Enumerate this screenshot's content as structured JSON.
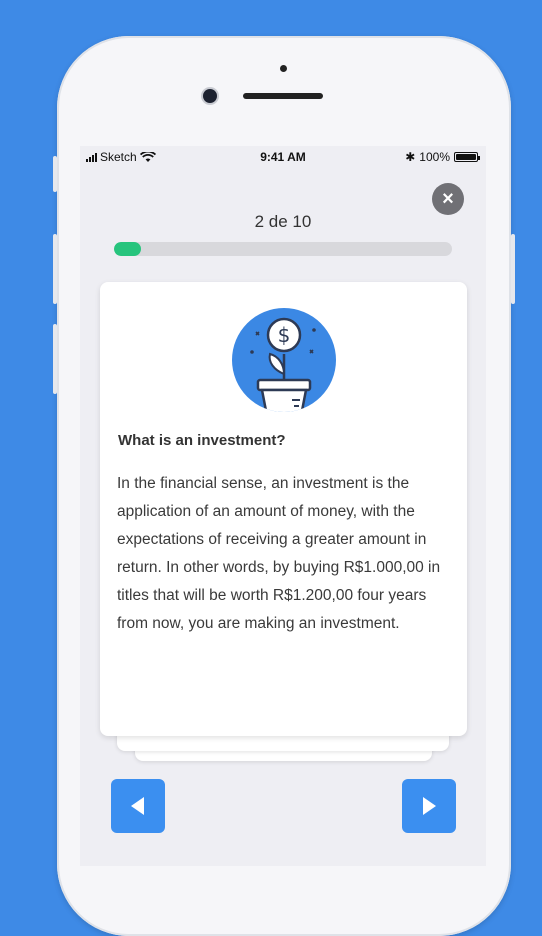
{
  "status_bar": {
    "carrier": "Sketch",
    "time": "9:41 AM",
    "bluetooth": "✱",
    "battery": "100%"
  },
  "close_label": "×",
  "progress": {
    "text": "2 de 10",
    "current": 2,
    "total": 10,
    "fraction": 0.08
  },
  "card": {
    "title": "What is an investment?",
    "body": "In the financial sense, an investment is the application of an amount of money, with the expectations of receiving a greater amount in return. In other words, by buying R$1.000,00 in titles that will be worth R$1.200,00 four years from now, you are making an investment.",
    "illustration_icon": "money-plant-icon"
  },
  "nav": {
    "prev_icon": "triangle-left-icon",
    "next_icon": "triangle-right-icon"
  },
  "colors": {
    "background": "#3e8ae6",
    "accent": "#3b8ff0",
    "progress": "#27c47d"
  }
}
